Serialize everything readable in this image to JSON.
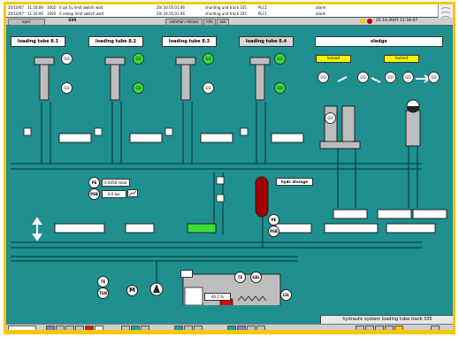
{
  "alarms": [
    {
      "date": "20/10/07",
      "time": "11:16:06",
      "code": "1002",
      "text": "0 zyl 5y limit switch wait",
      "ts2": "20/ 20.05.01.06",
      "group": "shunting unit track 335",
      "plc": "PLC1",
      "state": "alarm"
    },
    {
      "date": "20/10/07",
      "time": "11:16:06",
      "code": "1003",
      "text": "0 reloop limit switch wait",
      "ts2": "20/ 24.05.01.06",
      "group": "shunting unit track 335",
      "plc": "PLC1",
      "state": "alarm"
    }
  ],
  "status": {
    "mode": "open",
    "track": "335",
    "buttons": [
      "common release",
      "info",
      "ack"
    ],
    "datetime": "25.10.2007 11:16:07"
  },
  "tubes": [
    {
      "label": "loading tube 8.1"
    },
    {
      "label": "loading tube 8.2"
    },
    {
      "label": "loading tube 8.3"
    },
    {
      "label": "loading tube 8.4"
    }
  ],
  "sledge": {
    "label": "sledge",
    "lock_left": "locked",
    "lock_right": "locked"
  },
  "go_label": "GO",
  "pressure": {
    "pe_label": "PE",
    "value": "0.0058 mbar",
    "psb_label": "PSB",
    "value2": "0.0 bar"
  },
  "hydr_storage": "hydr. storage",
  "pe2_label": "PE",
  "psb2_label": "PSB",
  "te_label": "TE",
  "tsh_label": "TSH",
  "m_label": "M",
  "sal_label": "SAL",
  "lsl_label": "LSL",
  "tank_level": "40.2 %",
  "bottom_title": "hydraulic system loading tube track 335",
  "colors": {
    "background": "#1f8f8f",
    "frame": "#f5c800",
    "go_active": "#3cdc3c",
    "storage": "#a00000",
    "heater": "#e00000",
    "valve_active": "#3cdc3c"
  }
}
